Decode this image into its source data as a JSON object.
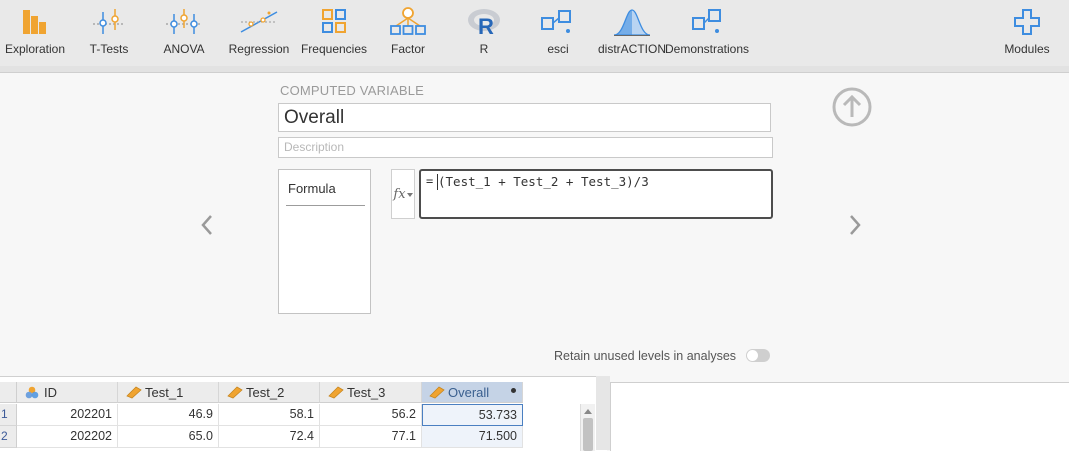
{
  "ribbon": {
    "items": [
      {
        "label": "Exploration",
        "icon": "exploration-icon"
      },
      {
        "label": "T-Tests",
        "icon": "t-tests-icon"
      },
      {
        "label": "ANOVA",
        "icon": "anova-icon"
      },
      {
        "label": "Regression",
        "icon": "regression-icon"
      },
      {
        "label": "Frequencies",
        "icon": "frequencies-icon"
      },
      {
        "label": "Factor",
        "icon": "factor-icon"
      },
      {
        "label": "R",
        "icon": "r-icon"
      },
      {
        "label": "esci",
        "icon": "esci-icon"
      },
      {
        "label": "distrACTION",
        "icon": "distraction-icon"
      },
      {
        "label": "Demonstrations",
        "icon": "demonstrations-icon"
      },
      {
        "label": "Modules",
        "icon": "modules-icon"
      }
    ]
  },
  "editor": {
    "section_title": "COMPUTED VARIABLE",
    "name_value": "Overall",
    "description_placeholder": "Description",
    "formula_tab": "Formula",
    "fx_label": "fx",
    "equals": "=",
    "formula": "(Test_1 + Test_2 + Test_3)/3",
    "retain_label": "Retain unused levels in analyses",
    "retain_on": false
  },
  "grid": {
    "columns": [
      {
        "name": "ID",
        "icon": "id-variable-icon"
      },
      {
        "name": "Test_1",
        "icon": "continuous-variable-icon"
      },
      {
        "name": "Test_2",
        "icon": "continuous-variable-icon"
      },
      {
        "name": "Test_3",
        "icon": "continuous-variable-icon"
      },
      {
        "name": "Overall",
        "icon": "computed-variable-icon"
      }
    ],
    "rows": [
      {
        "num": "1",
        "cells": [
          "202201",
          "46.9",
          "58.1",
          "56.2",
          "53.733"
        ]
      },
      {
        "num": "2",
        "cells": [
          "202202",
          "65.0",
          "72.4",
          "77.1",
          "71.500"
        ]
      }
    ]
  },
  "colors": {
    "ribbon_orange": "#f0a431",
    "ribbon_blue": "#3e8de0",
    "selection": "#4a7fc1",
    "row_number": "#3b5998"
  }
}
